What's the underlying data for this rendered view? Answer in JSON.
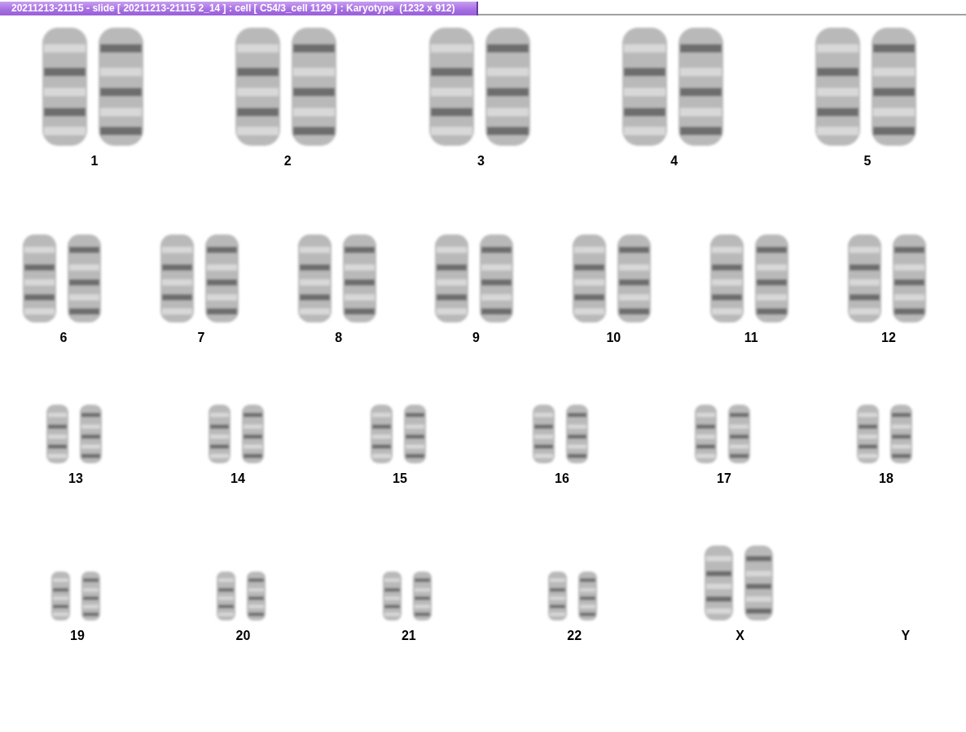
{
  "window": {
    "title": "20211213-21115 - slide [ 20211213-21115 2_14 ] : cell [ C54/3_cell 1129 ] : Karyotype  (1232 x 912)"
  },
  "karyotype": {
    "rows": [
      {
        "pairs": [
          {
            "label": "1",
            "kind": "pair"
          },
          {
            "label": "2",
            "kind": "pair"
          },
          {
            "label": "3",
            "kind": "pair"
          },
          {
            "label": "4",
            "kind": "pair"
          },
          {
            "label": "5",
            "kind": "pair"
          }
        ]
      },
      {
        "pairs": [
          {
            "label": "6",
            "kind": "pair"
          },
          {
            "label": "7",
            "kind": "pair"
          },
          {
            "label": "8",
            "kind": "pair"
          },
          {
            "label": "9",
            "kind": "pair"
          },
          {
            "label": "10",
            "kind": "pair"
          },
          {
            "label": "11",
            "kind": "pair"
          },
          {
            "label": "12",
            "kind": "pair"
          }
        ]
      },
      {
        "pairs": [
          {
            "label": "13",
            "kind": "pair"
          },
          {
            "label": "14",
            "kind": "pair"
          },
          {
            "label": "15",
            "kind": "pair"
          },
          {
            "label": "16",
            "kind": "pair"
          },
          {
            "label": "17",
            "kind": "pair"
          },
          {
            "label": "18",
            "kind": "pair"
          }
        ]
      },
      {
        "pairs": [
          {
            "label": "19",
            "kind": "pair"
          },
          {
            "label": "20",
            "kind": "pair"
          },
          {
            "label": "21",
            "kind": "pair"
          },
          {
            "label": "22",
            "kind": "pair"
          },
          {
            "label": "X",
            "kind": "pair-large"
          },
          {
            "label": "Y",
            "kind": "none"
          }
        ]
      }
    ]
  }
}
